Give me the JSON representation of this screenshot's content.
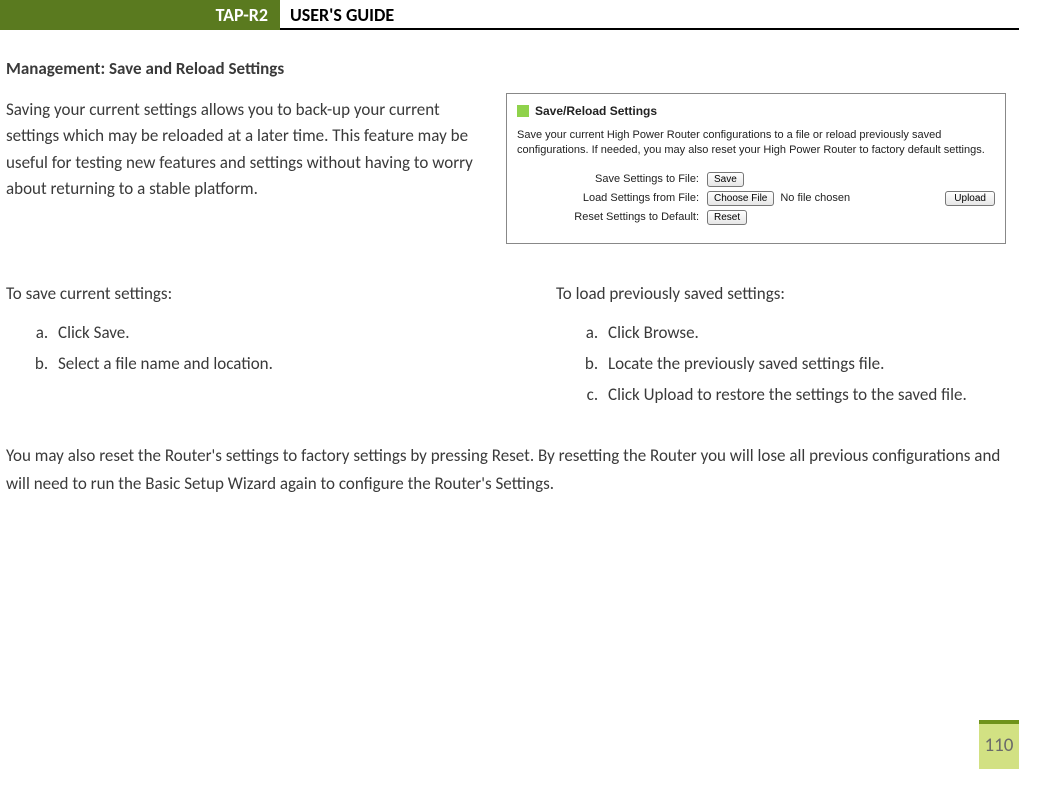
{
  "header": {
    "tab": "TAP-R2",
    "title": "USER'S GUIDE"
  },
  "section_title": "Management: Save and Reload Settings",
  "intro": "Saving your current settings allows you to back-up your current settings which may be reloaded at a later time.  This feature may be useful for testing new features and settings without having to worry about returning to a stable platform.",
  "panel": {
    "title": "Save/Reload Settings",
    "desc": "Save your current High Power Router configurations to a file or reload previously saved configurations. If needed, you may also reset your High Power Router to factory default settings.",
    "rows": {
      "save": {
        "label": "Save Settings to File:",
        "button": "Save"
      },
      "load": {
        "label": "Load Settings from File:",
        "choose": "Choose File",
        "file_text": "No file chosen",
        "upload": "Upload"
      },
      "reset": {
        "label": "Reset Settings to Default:",
        "button": "Reset"
      }
    }
  },
  "save_section": {
    "title": "To save current settings:",
    "items": [
      "Click Save.",
      "Select a file name and location."
    ]
  },
  "load_section": {
    "title": "To load previously saved settings:",
    "items": [
      "Click Browse.",
      "Locate the previously saved settings file.",
      "Click Upload to restore the settings to the saved file."
    ]
  },
  "reset_paragraph": "You may also reset the Router's settings to factory settings by pressing Reset.  By resetting the Router you will lose all previous configurations and will need to run the Basic Setup Wizard again to configure the Router's Settings.",
  "page_number": "110"
}
